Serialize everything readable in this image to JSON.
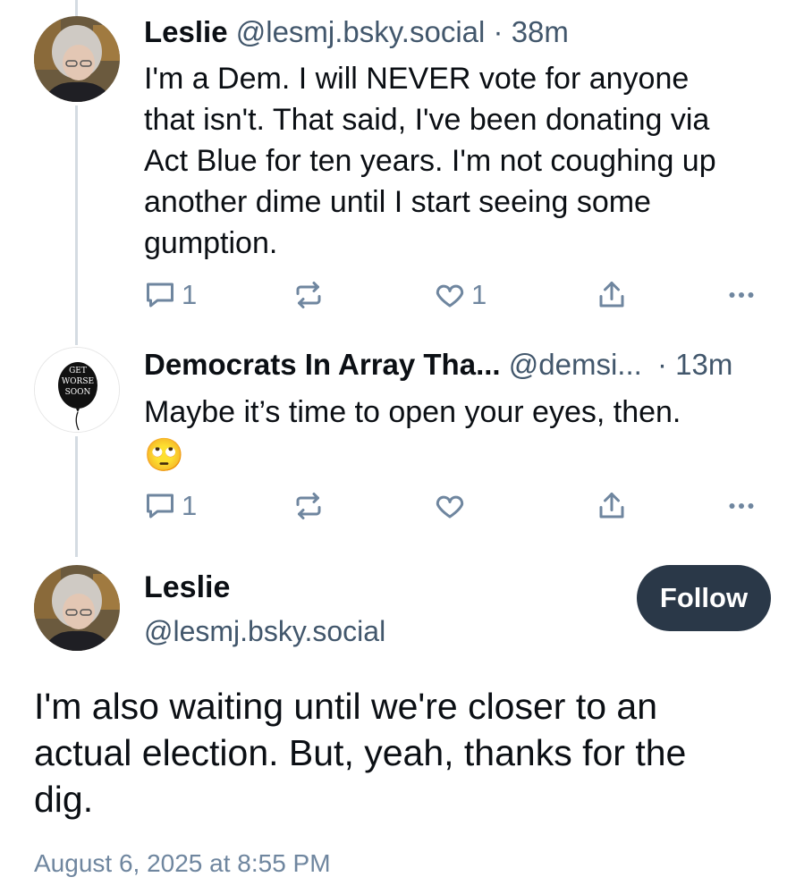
{
  "posts": [
    {
      "author_name": "Leslie",
      "handle": "@lesmj.bsky.social",
      "separator": "·",
      "time": "38m",
      "text_lines": [
        "I'm a Dem.  I will NEVER vote for anyone",
        "that isn't.  That said, I've been donating via",
        "Act Blue for ten years.  I'm not coughing up",
        "another dime until I start seeing some",
        "gumption."
      ],
      "reply_count": "1",
      "like_count": "1"
    },
    {
      "author_name": "Democrats In Array Tha...",
      "handle": "@demsi...",
      "separator": "·",
      "time": "13m",
      "text": "Maybe it’s time to open your eyes, then.",
      "emoji": "🙄",
      "reply_count": "1",
      "avatar_text": [
        "GET",
        "WORSE",
        "SOON"
      ]
    }
  ],
  "focus_post": {
    "author_name": "Leslie",
    "handle": "@lesmj.bsky.social",
    "follow_label": "Follow",
    "text_lines": [
      "I'm also waiting until we're closer to an",
      "actual election.  But, yeah, thanks for the",
      "dig."
    ],
    "timestamp": "August 6, 2025 at 8:55 PM"
  },
  "icons": {
    "reply": "reply-icon",
    "repost": "repost-icon",
    "like": "heart-icon",
    "share": "share-icon",
    "more": "more-options-icon"
  },
  "colors": {
    "follow_bg": "#2a3848",
    "muted": "#6f869f",
    "thread_line": "#d4dbe2"
  }
}
